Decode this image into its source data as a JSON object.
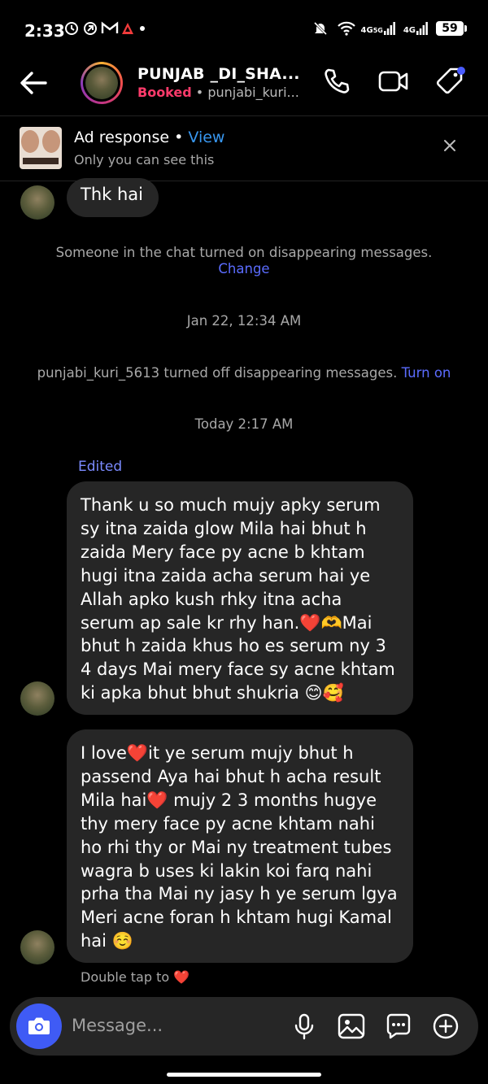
{
  "status_bar": {
    "time": "2:33",
    "network_1": "4G",
    "network_2": "4G",
    "network_1_suffix": "5G",
    "battery": "59"
  },
  "header": {
    "contact_name": "PUNJAB _DI_SHA...",
    "status": "Booked",
    "separator": " • ",
    "handle": "punjabi_kuri..."
  },
  "ad_response": {
    "title": "Ad response",
    "separator": " • ",
    "view_label": "View",
    "subtitle": "Only you can see this"
  },
  "messages": [
    {
      "text": "Thk hai"
    },
    {
      "text": "Thank u so much mujy apky serum sy itna zaida glow Mila hai bhut h zaida Mery face py acne b khtam hugi itna zaida acha serum hai ye Allah apko kush rhky itna acha serum ap sale kr rhy han.❤️🫶Mai bhut h zaida khus ho es serum ny 3 4 days Mai mery face sy acne khtam ki apka bhut bhut shukria 😊🥰"
    },
    {
      "text": "I love❤️it ye serum mujy bhut h passend Aya hai bhut h acha result Mila hai❤️ mujy 2 3 months hugye thy mery face py acne khtam nahi ho rhi thy or Mai ny treatment tubes wagra b uses ki lakin koi farq nahi prha tha Mai ny jasy h ye serum lgya Meri acne foran h khtam hugi Kamal hai ☺️"
    }
  ],
  "system": {
    "disappearing_on": "Someone in the chat turned on disappearing messages.",
    "change_label": "Change",
    "date_1": "Jan 22, 12:34 AM",
    "disappearing_off": "punjabi_kuri_5613 turned off disappearing messages.",
    "turn_on_label": "Turn on",
    "date_2": "Today 2:17 AM"
  },
  "edited_label": "Edited",
  "double_tap": "Double tap to ❤️",
  "composer": {
    "placeholder": "Message..."
  },
  "colors": {
    "background": "#000000",
    "bubble": "#262626",
    "booked": "#ff3b6b",
    "link": "#5b6cff",
    "camera_button": "#3f5bf5"
  },
  "icons": [
    "back-arrow-icon",
    "phone-icon",
    "video-call-icon",
    "tag-icon",
    "close-icon",
    "camera-icon",
    "microphone-icon",
    "gallery-icon",
    "sticker-icon",
    "plus-circle-icon"
  ]
}
